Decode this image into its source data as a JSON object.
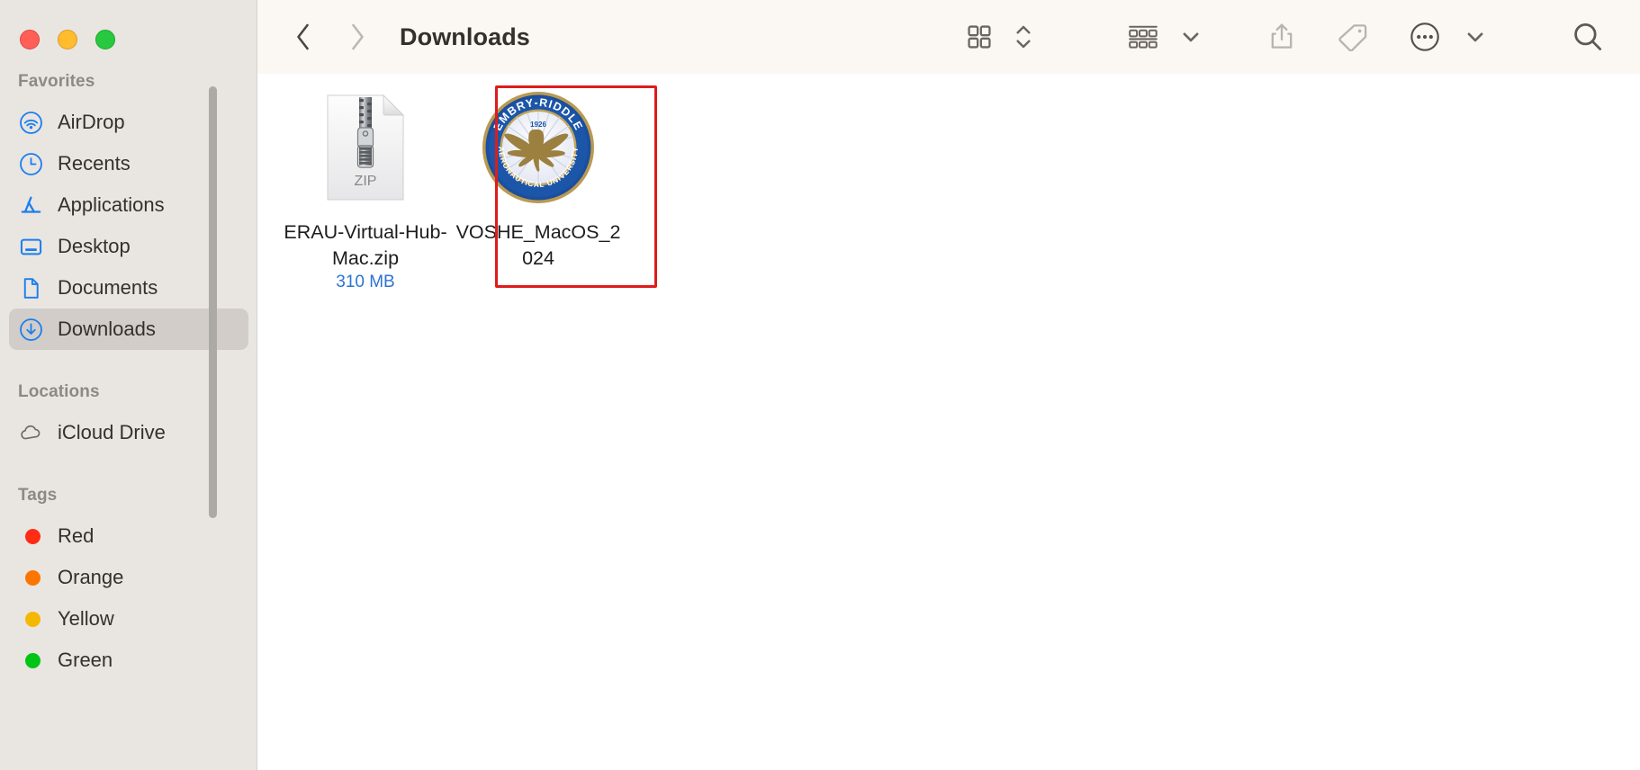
{
  "window": {
    "traffic_lights": [
      {
        "name": "close",
        "color": "#ff5f57"
      },
      {
        "name": "minimize",
        "color": "#febc2e"
      },
      {
        "name": "zoom",
        "color": "#28c840"
      }
    ]
  },
  "toolbar": {
    "back_label": "Back",
    "forward_label": "Forward",
    "title": "Downloads",
    "buttons": [
      {
        "name": "icon-view-button",
        "label": "Icon View",
        "icon": "grid-icon"
      },
      {
        "name": "view-stepper",
        "label": "Change View",
        "icon": "chevron-updown-icon"
      },
      {
        "name": "group-by-button",
        "label": "Group Items",
        "icon": "group-list-icon"
      },
      {
        "name": "group-by-chevron",
        "label": "Group Options",
        "icon": "chevron-down-icon"
      },
      {
        "name": "share-button",
        "label": "Share",
        "icon": "share-icon"
      },
      {
        "name": "tag-button",
        "label": "Add Tags",
        "icon": "tag-icon"
      },
      {
        "name": "more-button",
        "label": "More",
        "icon": "ellipsis-circle-icon"
      },
      {
        "name": "more-chevron",
        "label": "More Options",
        "icon": "chevron-down-icon"
      },
      {
        "name": "search-button",
        "label": "Search",
        "icon": "search-icon"
      }
    ]
  },
  "sidebar": {
    "sections": [
      {
        "title": "Favorites",
        "items": [
          {
            "label": "AirDrop",
            "icon": "airdrop-icon",
            "selected": false
          },
          {
            "label": "Recents",
            "icon": "clock-icon",
            "selected": false
          },
          {
            "label": "Applications",
            "icon": "applications-icon",
            "selected": false
          },
          {
            "label": "Desktop",
            "icon": "desktop-icon",
            "selected": false
          },
          {
            "label": "Documents",
            "icon": "document-icon",
            "selected": false
          },
          {
            "label": "Downloads",
            "icon": "downloads-icon",
            "selected": true
          }
        ]
      },
      {
        "title": "Locations",
        "items": [
          {
            "label": "iCloud Drive",
            "icon": "cloud-icon",
            "selected": false
          }
        ]
      },
      {
        "title": "Tags",
        "items": [
          {
            "label": "Red",
            "icon": "tag-dot",
            "color": "#ff2d16",
            "selected": false
          },
          {
            "label": "Orange",
            "icon": "tag-dot",
            "color": "#fb7500",
            "selected": false
          },
          {
            "label": "Yellow",
            "icon": "tag-dot",
            "color": "#f5b800",
            "selected": false
          },
          {
            "label": "Green",
            "icon": "tag-dot",
            "color": "#00c514",
            "selected": false
          }
        ]
      }
    ]
  },
  "files": [
    {
      "name": "ERAU-Virtual-Hub-Mac.zip",
      "size": "310 MB",
      "icon": "zip-archive-icon",
      "icon_badge": "ZIP",
      "selected": true,
      "highlighted": true
    },
    {
      "name": "VOSHE_MacOS_2024",
      "size": "",
      "icon": "embry-riddle-seal-icon",
      "icon_badge": "",
      "selected": false,
      "highlighted": false
    }
  ],
  "annotation": {
    "highlight_color": "#e01b1b",
    "target": "ERAU-Virtual-Hub-Mac.zip"
  },
  "colors": {
    "sidebar_bg": "#e9e5e1",
    "toolbar_bg": "#fbf7f3",
    "content_bg": "#ffffff",
    "accent_blue": "#2a74d4",
    "selection_gray": "#d2cdc8",
    "icon_blue": "#0a84ff"
  }
}
